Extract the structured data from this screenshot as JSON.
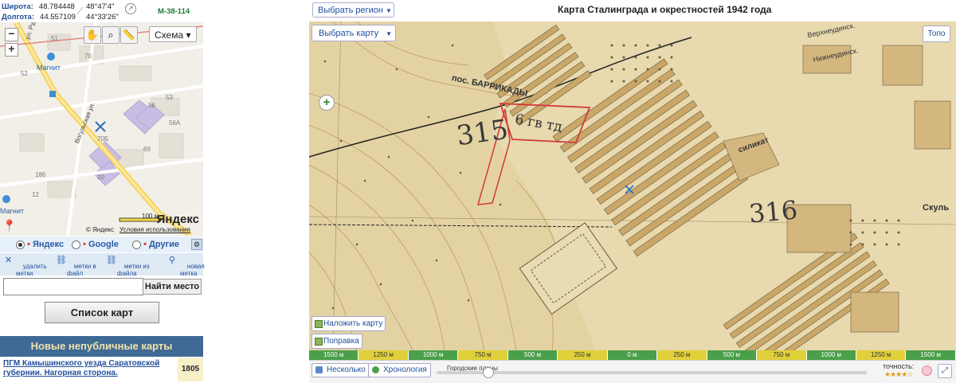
{
  "coords": {
    "lat_label": "Широта:",
    "lat_value": "48.784448",
    "lat_dms": "48°47'4\"",
    "lon_label": "Долгота:",
    "lon_value": "44.557109",
    "lon_dms": "44°33'26\"",
    "sheet": "M-38-114"
  },
  "small_map": {
    "scheme_label": "Схема ▾",
    "poi_1": "Магнит",
    "poi_2": "Магнит",
    "street_1": "ул. Рудн",
    "street_2": "Вогульская ул.",
    "house_numbers": [
      "51",
      "52",
      "70",
      "53",
      "56",
      "70Б",
      "56А",
      "69",
      "186",
      "20",
      "12"
    ],
    "scale_label": "100 м",
    "logo": "Яндекс",
    "copyright": "© Яндекс",
    "terms": "Условия использования"
  },
  "providers": {
    "yandex": "Яндекс",
    "google": "Google",
    "other": "Другие",
    "selected": "yandex"
  },
  "marks": {
    "delete": "удалить\nметки",
    "to_file": "метки в\nфайл",
    "from_file": "метки из\nфайла",
    "new_mark": "новая\nметка"
  },
  "search": {
    "value": "",
    "button": "Найти место"
  },
  "map_list_button": "Список карт",
  "new_maps": {
    "heading": "Новые непубличные карты",
    "item_title": "ПГМ Камышинского уезда Саратовской губернии. Нагорная сторона.",
    "item_year": "1805"
  },
  "main": {
    "region_btn": "Выбрать регион",
    "title": "Карта Сталинграда и окрестностей 1942 года",
    "choose_map_btn": "Выбрать карту",
    "topo_btn": "Топо",
    "overlay_btn": "Наложить карту",
    "correction_btn": "Поправка",
    "map_labels": {
      "settlement": "пос. БАРРИКАДЫ",
      "div_number_1": "315",
      "unit_label": "6 гв тд",
      "div_number_2": "316",
      "silikat": "силикат",
      "verkhne": "Верхнеудинск.",
      "nizhne": "Нижнеудинск.",
      "skul": "Скуль"
    }
  },
  "scale_bar": [
    {
      "label": "1500 м",
      "color": "#4aa04a"
    },
    {
      "label": "1250 м",
      "color": "#e0d03a"
    },
    {
      "label": "1000 м",
      "color": "#4aa04a"
    },
    {
      "label": "750 м",
      "color": "#e0d03a"
    },
    {
      "label": "500 м",
      "color": "#4aa04a"
    },
    {
      "label": "250 м",
      "color": "#e0d03a"
    },
    {
      "label": "0 м",
      "color": "#4aa04a"
    },
    {
      "label": "250 м",
      "color": "#e0d03a"
    },
    {
      "label": "500 м",
      "color": "#4aa04a"
    },
    {
      "label": "750 м",
      "color": "#e0d03a"
    },
    {
      "label": "1000 м",
      "color": "#4aa04a"
    },
    {
      "label": "1250 м",
      "color": "#e0d03a"
    },
    {
      "label": "1500 м",
      "color": "#4aa04a"
    }
  ],
  "bottom": {
    "several_btn": "Несколько",
    "chronology_btn": "Хронология",
    "city_plans": "Городские планы",
    "accuracy_label": "точность:",
    "stars": "★★★★☆"
  },
  "colors": {
    "accent_blue": "#1f4e9c",
    "map_paper": "#e6d7ac",
    "header_blue": "#3f6a96"
  }
}
